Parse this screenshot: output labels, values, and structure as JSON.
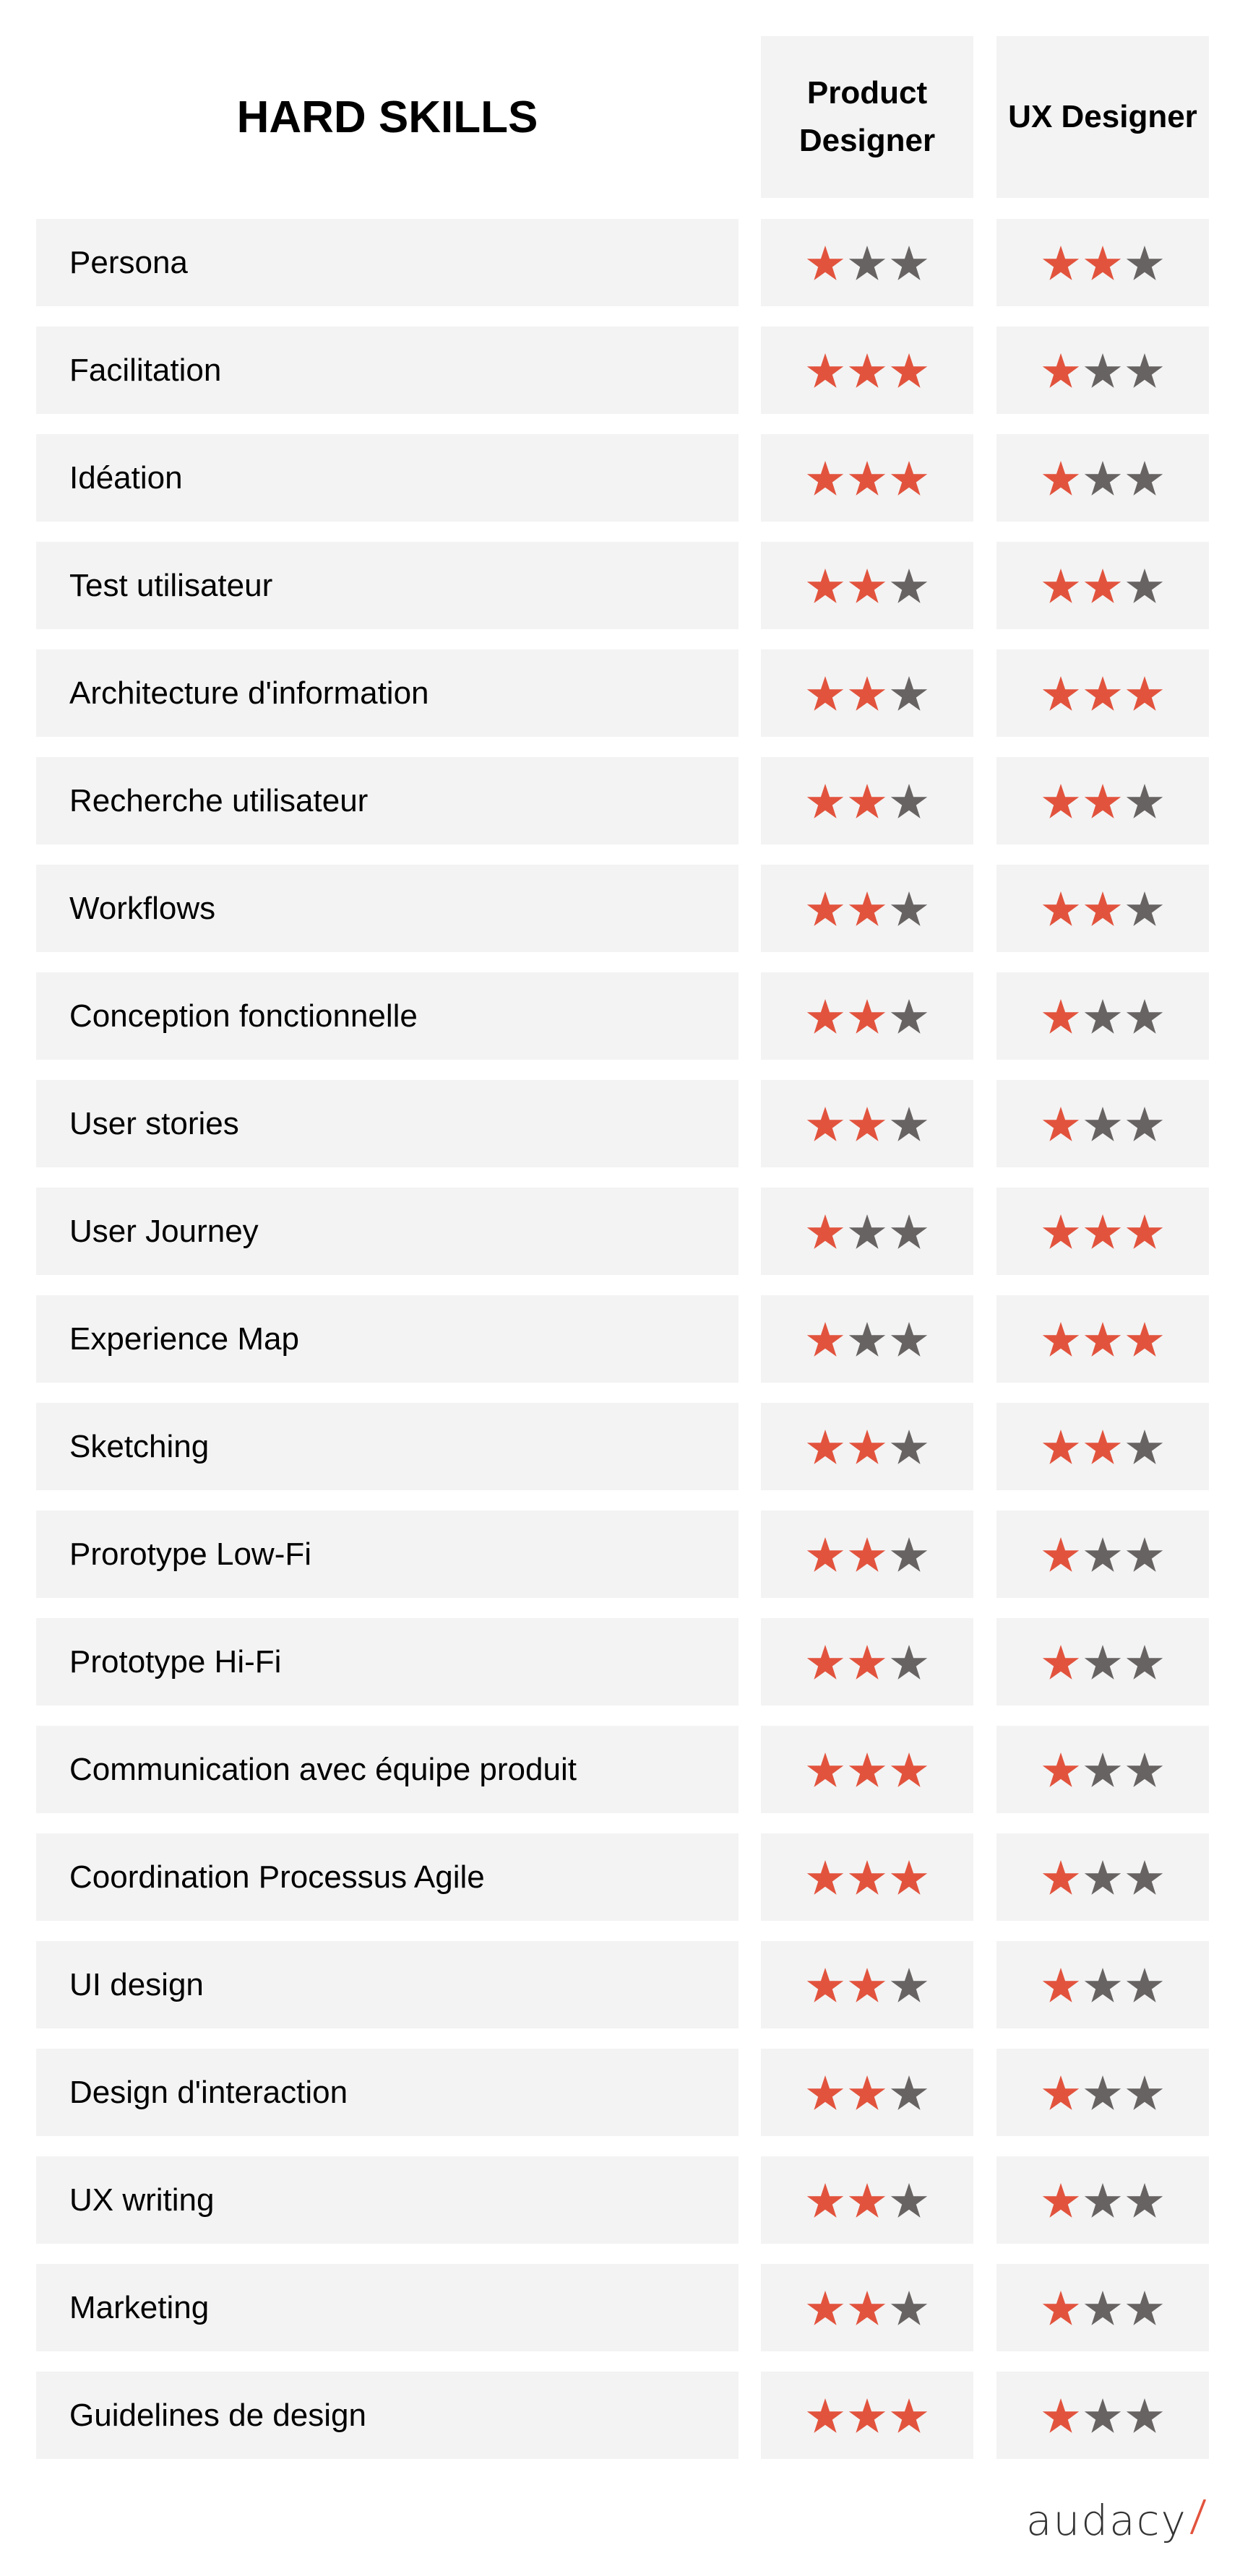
{
  "header": {
    "title": "HARD SKILLS",
    "columns": [
      {
        "key": "product_designer",
        "lines": [
          "Product",
          "Designer"
        ]
      },
      {
        "key": "ux_designer",
        "lines": [
          "UX Designer"
        ]
      }
    ]
  },
  "rating_scale_max": 3,
  "colors": {
    "star_filled": "#E2533D",
    "star_empty": "#676362",
    "cell_background": "#F3F3F3",
    "logo_text": "#333333",
    "logo_accent": "#E2533D"
  },
  "icons": {
    "filled_star": "star-filled-icon",
    "empty_star": "star-empty-icon"
  },
  "skills": [
    {
      "label": "Persona",
      "product_designer": 1,
      "ux_designer": 2
    },
    {
      "label": "Facilitation",
      "product_designer": 3,
      "ux_designer": 1
    },
    {
      "label": "Idéation",
      "product_designer": 3,
      "ux_designer": 1
    },
    {
      "label": "Test utilisateur",
      "product_designer": 2,
      "ux_designer": 2
    },
    {
      "label": "Architecture d'information",
      "product_designer": 2,
      "ux_designer": 3
    },
    {
      "label": "Recherche utilisateur",
      "product_designer": 2,
      "ux_designer": 2
    },
    {
      "label": "Workflows",
      "product_designer": 2,
      "ux_designer": 2
    },
    {
      "label": "Conception fonctionnelle",
      "product_designer": 2,
      "ux_designer": 1
    },
    {
      "label": "User stories",
      "product_designer": 2,
      "ux_designer": 1
    },
    {
      "label": "User Journey",
      "product_designer": 1,
      "ux_designer": 3
    },
    {
      "label": "Experience Map",
      "product_designer": 1,
      "ux_designer": 3
    },
    {
      "label": "Sketching",
      "product_designer": 2,
      "ux_designer": 2
    },
    {
      "label": "Prorotype Low-Fi",
      "product_designer": 2,
      "ux_designer": 1
    },
    {
      "label": "Prototype Hi-Fi",
      "product_designer": 2,
      "ux_designer": 1
    },
    {
      "label": "Communication avec équipe produit",
      "product_designer": 3,
      "ux_designer": 1
    },
    {
      "label": "Coordination Processus Agile",
      "product_designer": 3,
      "ux_designer": 1
    },
    {
      "label": "UI design",
      "product_designer": 2,
      "ux_designer": 1
    },
    {
      "label": "Design d'interaction",
      "product_designer": 2,
      "ux_designer": 1
    },
    {
      "label": "UX writing",
      "product_designer": 2,
      "ux_designer": 1
    },
    {
      "label": "Marketing",
      "product_designer": 2,
      "ux_designer": 1
    },
    {
      "label": "Guidelines de design",
      "product_designer": 3,
      "ux_designer": 1
    }
  ],
  "footer": {
    "logo_text": "audacy",
    "logo_icon": "slash-icon"
  }
}
